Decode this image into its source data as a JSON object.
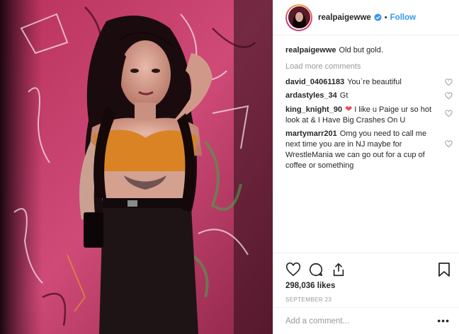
{
  "post": {
    "author": "realpaigewwe",
    "verified": true,
    "follow_label": "Follow",
    "separator": "•",
    "caption": {
      "user": "realpaigewwe",
      "text": "Old but gold."
    },
    "load_more_label": "Load more comments",
    "comments": [
      {
        "user": "david_04061183",
        "text": "You`re beautiful",
        "emoji": ""
      },
      {
        "user": "ardastyles_34",
        "text": "Gt",
        "emoji": ""
      },
      {
        "user": "king_knight_90",
        "emoji": "❤",
        "text": "I like u Paige ur so hot look at & I Have Big Crashes On U"
      },
      {
        "user": "martymarr201",
        "text": "Omg you need to call me next time you are in NJ maybe for WrestleMania we can go out for a cup of coffee or something",
        "emoji": ""
      }
    ],
    "likes": "298,036 likes",
    "date": "SEPTEMBER 23",
    "add_comment_placeholder": "Add a comment...",
    "more_options": "•••"
  },
  "icons": {
    "like": "heart-icon",
    "comment": "comment-icon",
    "share": "share-icon",
    "save": "bookmark-icon",
    "verified": "verified-badge-icon"
  },
  "colors": {
    "follow": "#3897f0",
    "muted": "#999999",
    "heart": "#ed4956",
    "photo_wall": "#c23a6a"
  }
}
